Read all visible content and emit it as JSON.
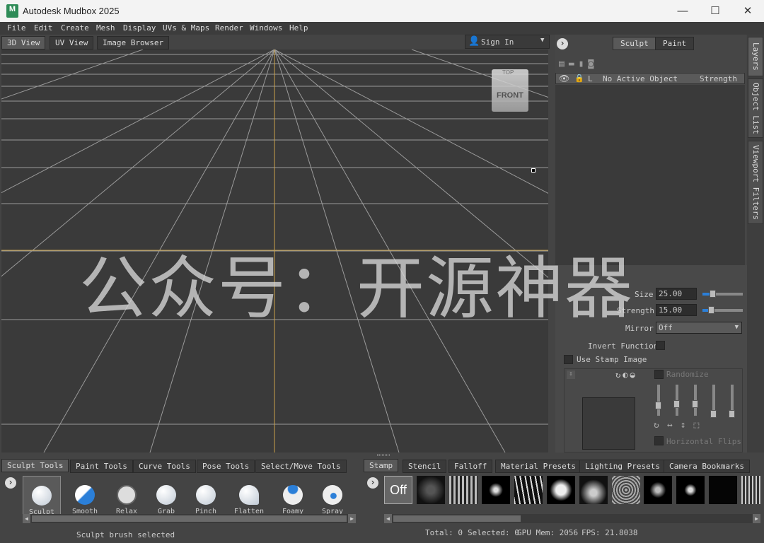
{
  "window": {
    "title": "Autodesk Mudbox 2025",
    "icon_letter": "M",
    "minimize": "—",
    "maximize": "☐",
    "close": "✕"
  },
  "menu": [
    "File",
    "Edit",
    "Create",
    "Mesh",
    "Display",
    "UVs & Maps",
    "Render",
    "Windows",
    "Help"
  ],
  "view_tabs": [
    "3D View",
    "UV View",
    "Image Browser"
  ],
  "sign_in": "Sign In",
  "viewcube": {
    "top": "TOP",
    "front": "FRONT"
  },
  "watermark": "公众号：开源神器",
  "mode_tabs": [
    "Sculpt",
    "Paint"
  ],
  "side_tabs": [
    "Layers",
    "Object List",
    "Viewport Filters"
  ],
  "layers": {
    "col_l": "L",
    "col_name": "No Active Object",
    "col_strength": "Strength"
  },
  "props": {
    "size_label": "Size",
    "size_value": "25.00",
    "strength_label": "Strength",
    "strength_value": "15.00",
    "mirror_label": "Mirror",
    "mirror_value": "Off",
    "invert_label": "Invert Function",
    "stamp_label": "Use Stamp Image",
    "randomize_label": "Randomize",
    "hflips_label": "Horizontal Flips"
  },
  "tool_tabs": [
    "Sculpt Tools",
    "Paint Tools",
    "Curve Tools",
    "Pose Tools",
    "Select/Move Tools"
  ],
  "brushes": [
    "Sculpt",
    "Smooth",
    "Relax",
    "Grab",
    "Pinch",
    "Flatten",
    "Foamy",
    "Spray"
  ],
  "stamp_tabs": [
    "Stamp",
    "Stencil",
    "Falloff",
    "Material Presets",
    "Lighting Presets",
    "Camera Bookmarks"
  ],
  "stamp_off": "Off",
  "status": {
    "message": "Sculpt brush selected",
    "total": "Total: 0",
    "selected": "Selected: 0",
    "gpu": "GPU Mem: 2056",
    "fps": "FPS: 21.8038"
  },
  "colors": {
    "accent": "#2b7fd8",
    "grid": "#9a9a9a",
    "axis": "#c9a34a"
  }
}
